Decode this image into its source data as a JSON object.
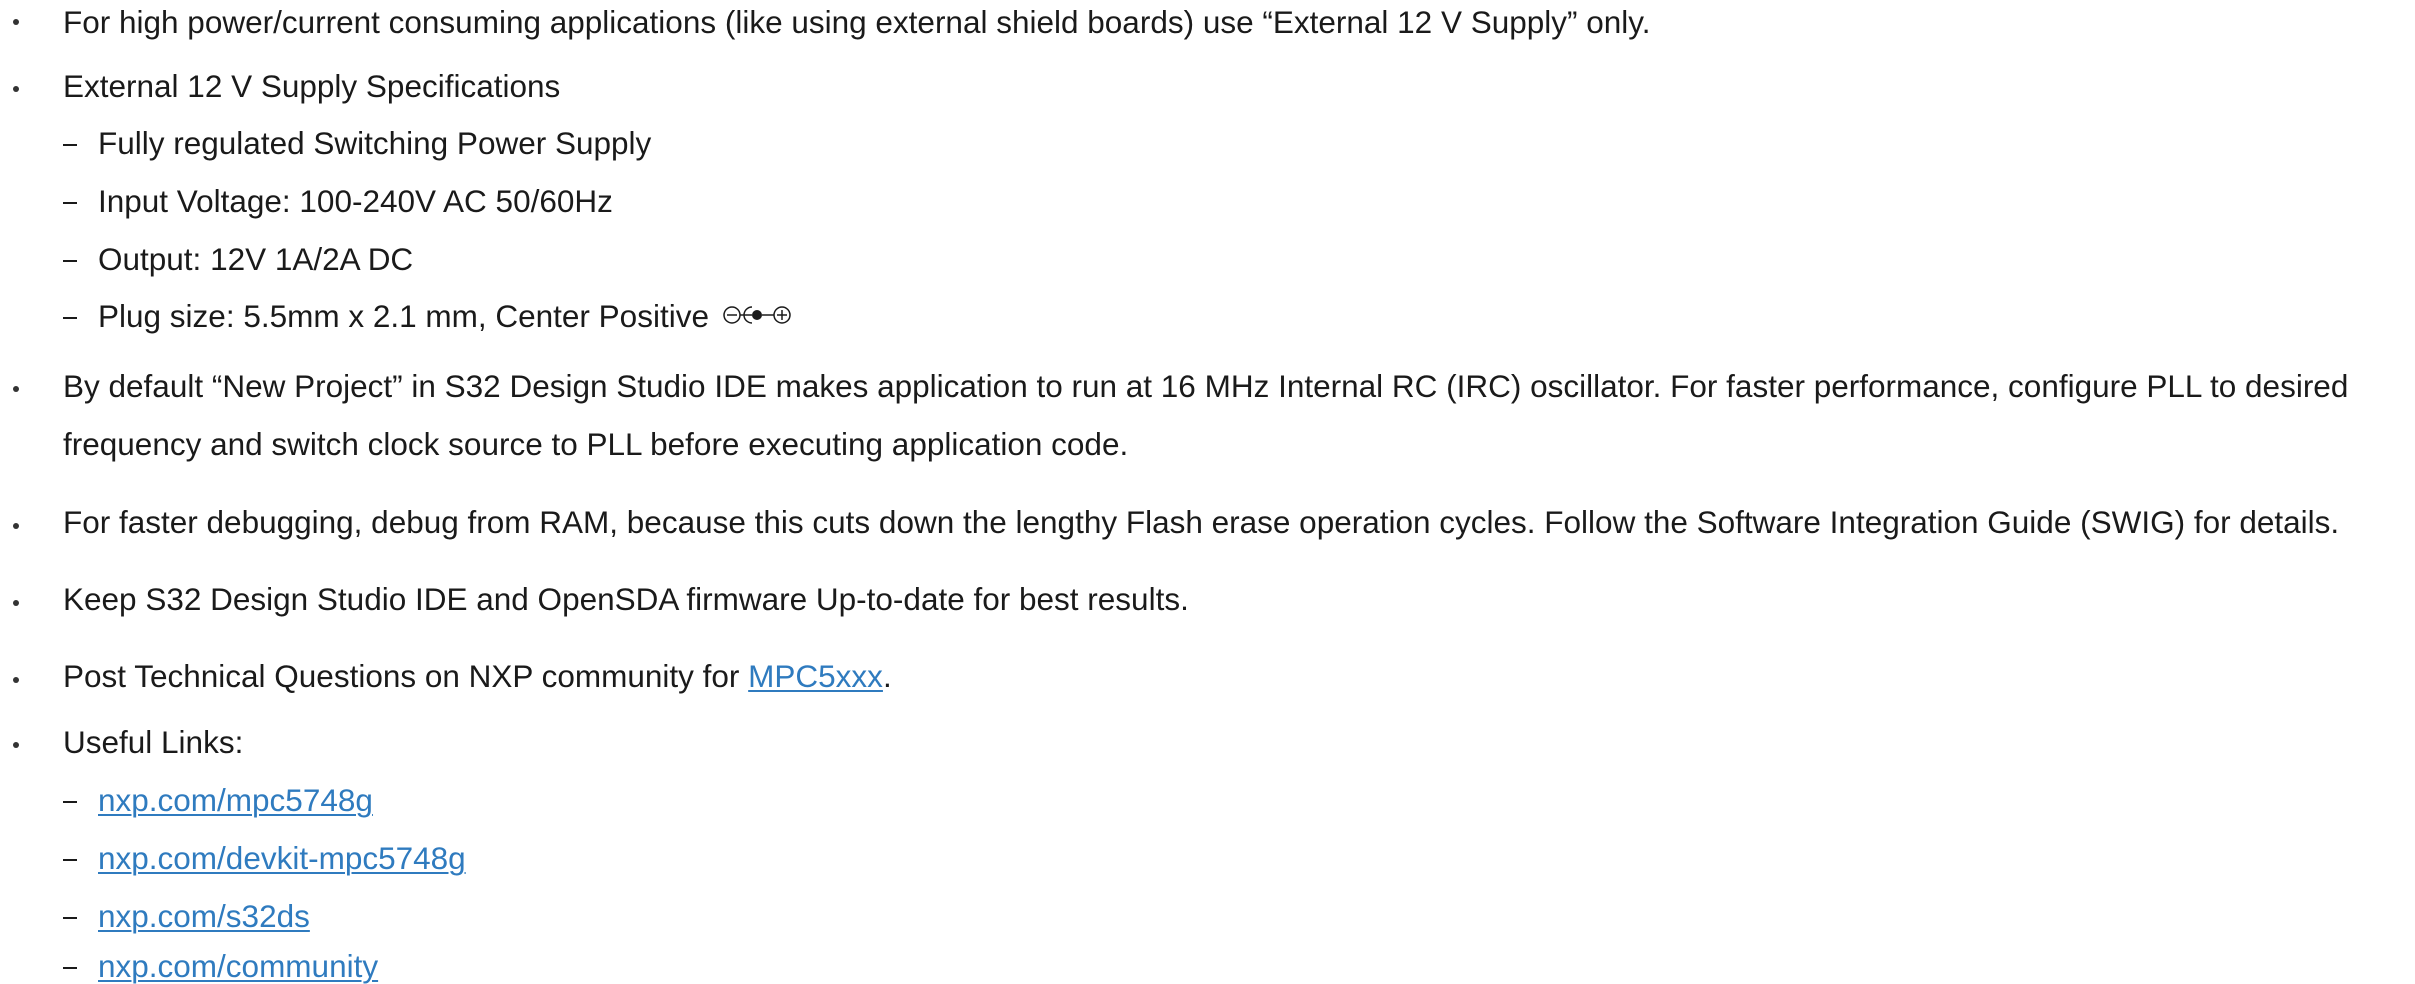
{
  "items": [
    {
      "text": "For high power/current consuming applications (like using external shield boards) use “External 12 V Supply” only."
    },
    {
      "text": "External 12 V Supply Specifications",
      "subs": [
        "Fully regulated Switching Power Supply",
        "Input Voltage: 100-240V AC 50/60Hz",
        "Output: 12V 1A/2A DC",
        "Plug size: 5.5mm x 2.1 mm, Center Positive"
      ]
    },
    {
      "line1": "By default “New Project” in S32 Design Studio IDE makes application to run at 16 MHz Internal RC (IRC) oscillator. For faster performance, configure PLL to desired",
      "line2": "frequency and switch clock source to PLL before executing application code."
    },
    {
      "text": "For faster debugging, debug from RAM, because this cuts down the lengthy Flash erase operation cycles. Follow the Software Integration Guide (SWIG) for details."
    },
    {
      "text": "Keep S32 Design Studio IDE and OpenSDA firmware Up-to-date for best results."
    },
    {
      "prefix": "Post Technical Questions on NXP community for ",
      "link": "MPC5xxx",
      "suffix": "."
    },
    {
      "text": "Useful Links:",
      "links": [
        "nxp.com/mpc5748g",
        "nxp.com/devkit-mpc5748g",
        "nxp.com/s32ds",
        "nxp.com/community"
      ]
    }
  ],
  "colors": {
    "link": "#2f7bbf",
    "text": "#1a1a1a"
  },
  "icons": {
    "plug": "center-positive-polarity-icon"
  }
}
